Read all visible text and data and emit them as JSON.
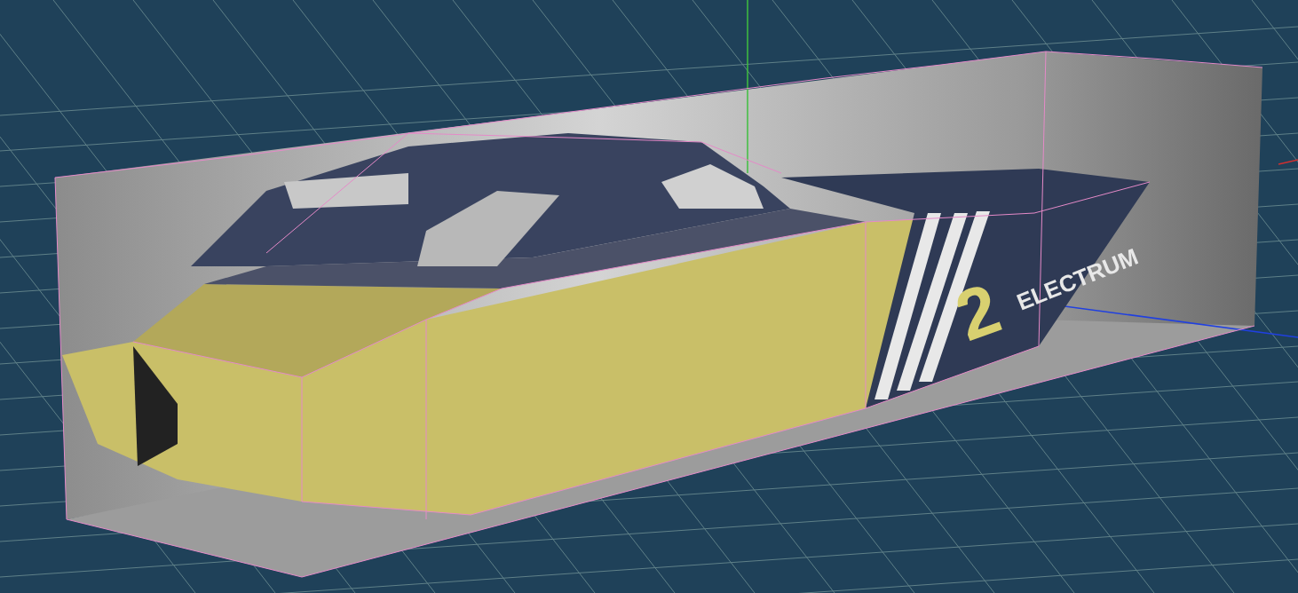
{
  "viewport": {
    "livery": {
      "number": "2",
      "name": "ELECTRUM"
    }
  }
}
